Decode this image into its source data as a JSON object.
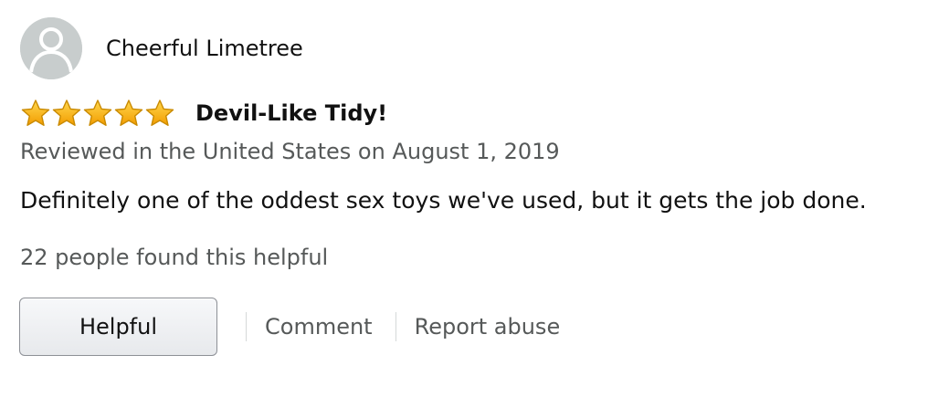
{
  "reviewer": {
    "name": "Cheerful Limetree",
    "avatar_icon": "default-user-silhouette-icon"
  },
  "review": {
    "rating": 5,
    "rating_max": 5,
    "star_icon": "filled-star-icon",
    "star_color": "#f5b400",
    "title": "Devil-Like Tidy!",
    "date_line": "Reviewed in the United States on August 1, 2019",
    "body": "Definitely one of the oddest sex toys we've used, but it gets the job done."
  },
  "helpfulness": {
    "count_text": "22 people found this helpful"
  },
  "actions": {
    "helpful_label": "Helpful",
    "comment_label": "Comment",
    "report_label": "Report abuse"
  },
  "colors": {
    "text_primary": "#111111",
    "text_secondary": "#565959",
    "avatar_bg": "#c8cdcd"
  }
}
